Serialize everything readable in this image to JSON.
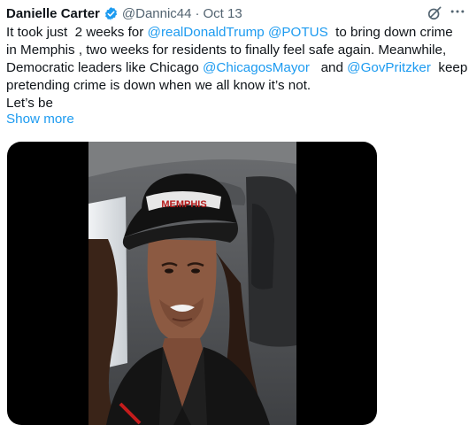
{
  "tweet": {
    "author_name": "Danielle Carter",
    "handle": "@Dannic44",
    "separator": "·",
    "date": "Oct 13",
    "lines": [
      [
        {
          "t": "It took just  2 weeks for "
        },
        {
          "t": "@realDonaldTrump",
          "m": true
        },
        {
          "t": " "
        },
        {
          "t": "@POTUS",
          "m": true
        },
        {
          "t": "  to bring down crime"
        }
      ],
      [
        {
          "t": "in Memphis , two weeks for residents to finally feel safe again. Meanwhile,"
        }
      ],
      [
        {
          "t": "Democratic leaders like Chicago "
        },
        {
          "t": "@ChicagosMayor",
          "m": true
        },
        {
          "t": "   and "
        },
        {
          "t": "@GovPritzker",
          "m": true
        },
        {
          "t": "  keep"
        }
      ],
      [
        {
          "t": "pretending crime is down when we all know it’s not."
        }
      ],
      [
        {
          "t": "Let’s be"
        }
      ]
    ],
    "show_more": "Show more",
    "cap_text": "MEMPHIS"
  },
  "icons": {
    "verified": "verified-badge-icon",
    "grok": "grok-icon",
    "more": "more-options-icon"
  },
  "colors": {
    "text": "#0f1419",
    "secondary": "#536471",
    "link": "#1d9bf0",
    "media_bg": "#000000"
  }
}
